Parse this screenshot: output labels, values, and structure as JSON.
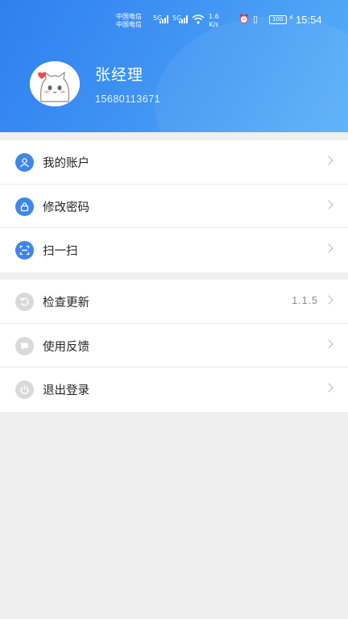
{
  "status_bar": {
    "carrier_1": "中国电信",
    "carrier_2": "中国电信",
    "net_1": "5G",
    "net_2": "5G",
    "speed_value": "1.6",
    "speed_unit": "K/s",
    "battery": "100",
    "time": "15:54"
  },
  "profile": {
    "name": "张经理",
    "phone": "15680113671"
  },
  "menu": {
    "account": "我的账户",
    "password": "修改密码",
    "scan": "扫一扫",
    "update": "检查更新",
    "version": "1.1.5",
    "feedback": "使用反馈",
    "logout": "退出登录"
  },
  "colors": {
    "header_start": "#2f7ff0",
    "header_end": "#58b0f8",
    "accent_blue": "#3d86ea",
    "icon_grey": "#d9d9d9"
  },
  "icons": {
    "account": "user-icon",
    "password": "lock-icon",
    "scan": "scan-icon",
    "update": "refresh-icon",
    "feedback": "message-icon",
    "logout": "power-icon"
  }
}
